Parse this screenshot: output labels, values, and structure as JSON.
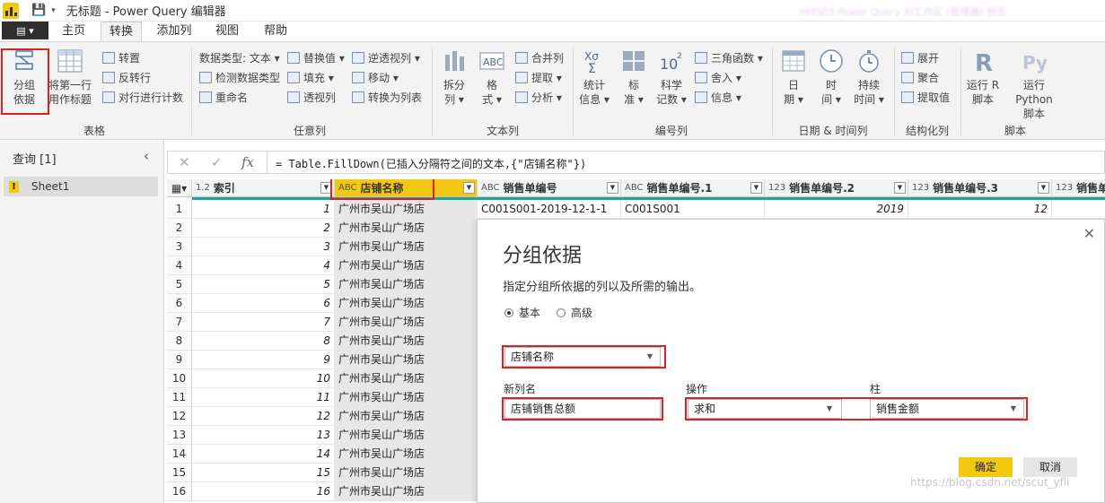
{
  "titlebar": {
    "title": "无标题 - Power Query 编辑器",
    "blurred_text": "HMS03 Power Query AI工作区 (管理器) 预览"
  },
  "tabs": {
    "file": "▤ ▾",
    "home": "主页",
    "transform": "转换",
    "add_column": "添加列",
    "view": "视图",
    "help": "帮助"
  },
  "ribbon": {
    "table": {
      "label": "表格",
      "group_by_l1": "分组",
      "group_by_l2": "依据",
      "first_row_l1": "将第一行",
      "first_row_l2": "用作标题",
      "transpose": "转置",
      "reverse_rows": "反转行",
      "count_rows": "对行进行计数"
    },
    "any_column": {
      "label": "任意列",
      "data_type": "数据类型: 文本 ▾",
      "detect_type": "检测数据类型",
      "rename": "重命名",
      "replace_values": "替换值 ▾",
      "fill": "填充 ▾",
      "pivot": "透视列",
      "unpivot": "逆透视列 ▾",
      "move": "移动 ▾",
      "to_list": "转换为列表"
    },
    "text_column": {
      "label": "文本列",
      "split_l1": "拆分",
      "split_l2": "列 ▾",
      "format_l1": "格",
      "format_l2": "式 ▾",
      "merge": "合并列",
      "extract": "提取 ▾",
      "parse": "分析 ▾"
    },
    "number_column": {
      "label": "编号列",
      "stats_l1": "统计",
      "stats_l2": "信息 ▾",
      "standard_l1": "标",
      "standard_l2": "准 ▾",
      "sci_l1": "科学",
      "sci_l2": "记数 ▾",
      "trig": "三角函数 ▾",
      "rounding": "舍入 ▾",
      "info": "信息 ▾"
    },
    "datetime": {
      "label": "日期 & 时间列",
      "date_l1": "日",
      "date_l2": "期 ▾",
      "time_l1": "时",
      "time_l2": "间 ▾",
      "duration_l1": "持续",
      "duration_l2": "时间 ▾"
    },
    "structured": {
      "label": "结构化列",
      "expand": "展开",
      "aggregate": "聚合",
      "extract_values": "提取值"
    },
    "scripts": {
      "label": "脚本",
      "r_l1": "运行 R",
      "r_l2": "脚本",
      "py_l1": "运行 Python",
      "py_l2": "脚本"
    }
  },
  "queries": {
    "header": "查询 [1]",
    "items": [
      "Sheet1"
    ]
  },
  "formula_bar": {
    "formula": "= Table.FillDown(已插入分隔符之间的文本,{\"店铺名称\"})"
  },
  "grid": {
    "columns": [
      {
        "type": "1.2",
        "name": "索引"
      },
      {
        "type": "ABC",
        "name": "店铺名称"
      },
      {
        "type": "ABC",
        "name": "销售单编号"
      },
      {
        "type": "ABC",
        "name": "销售单编号.1"
      },
      {
        "type": "123",
        "name": "销售单编号.2"
      },
      {
        "type": "123",
        "name": "销售单编号.3"
      },
      {
        "type": "123",
        "name": "销售单编"
      }
    ],
    "rows": [
      {
        "n": "1",
        "index": "1",
        "store": "广州市吴山广场店",
        "c3": "C001S001-2019-12-1-1",
        "c4": "C001S001",
        "c5": "2019",
        "c6": "12"
      },
      {
        "n": "2",
        "index": "2",
        "store": "广州市吴山广场店"
      },
      {
        "n": "3",
        "index": "3",
        "store": "广州市吴山广场店"
      },
      {
        "n": "4",
        "index": "4",
        "store": "广州市吴山广场店"
      },
      {
        "n": "5",
        "index": "5",
        "store": "广州市吴山广场店"
      },
      {
        "n": "6",
        "index": "6",
        "store": "广州市吴山广场店"
      },
      {
        "n": "7",
        "index": "7",
        "store": "广州市吴山广场店"
      },
      {
        "n": "8",
        "index": "8",
        "store": "广州市吴山广场店"
      },
      {
        "n": "9",
        "index": "9",
        "store": "广州市吴山广场店"
      },
      {
        "n": "10",
        "index": "10",
        "store": "广州市吴山广场店"
      },
      {
        "n": "11",
        "index": "11",
        "store": "广州市吴山广场店"
      },
      {
        "n": "12",
        "index": "12",
        "store": "广州市吴山广场店"
      },
      {
        "n": "13",
        "index": "13",
        "store": "广州市吴山广场店"
      },
      {
        "n": "14",
        "index": "14",
        "store": "广州市吴山广场店"
      },
      {
        "n": "15",
        "index": "15",
        "store": "广州市吴山广场店"
      },
      {
        "n": "16",
        "index": "16",
        "store": "广州市吴山广场店"
      }
    ]
  },
  "dialog": {
    "title": "分组依据",
    "description": "指定分组所依据的列以及所需的输出。",
    "radio_basic": "基本",
    "radio_advanced": "高级",
    "group_column": "店铺名称",
    "new_col_label": "新列名",
    "op_label": "操作",
    "col_label": "柱",
    "new_col_value": "店铺销售总额",
    "op_value": "求和",
    "col_value": "销售金额",
    "ok": "确定",
    "cancel": "取消"
  },
  "watermark": "https://blog.csdn.net/scut_yfli",
  "colors": {
    "accent": "#f2c811",
    "highlight": "#e02020",
    "teal": "#19a89a"
  }
}
